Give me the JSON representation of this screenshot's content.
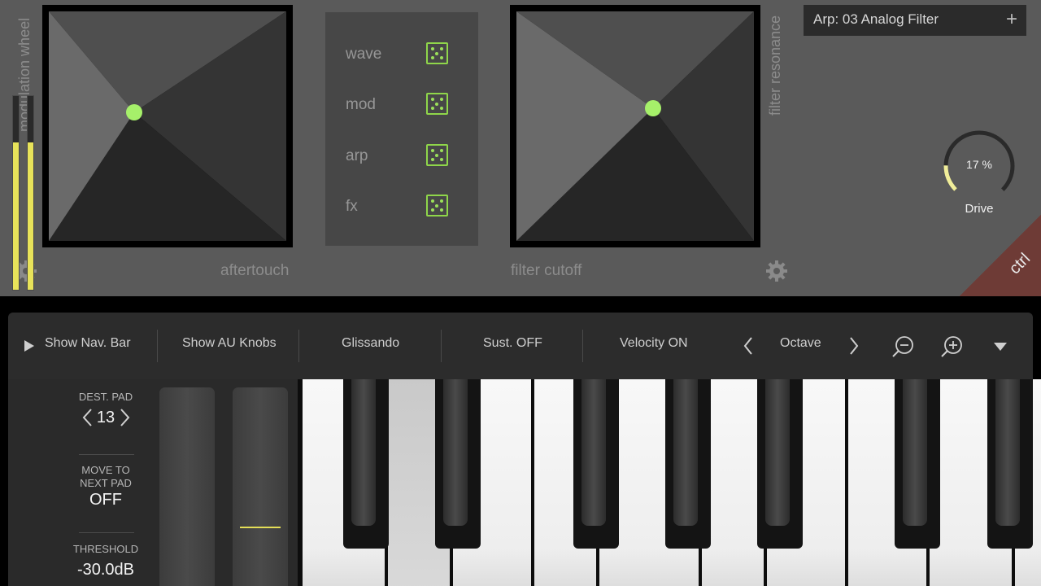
{
  "pads": {
    "left": {
      "x_label": "aftertouch",
      "y_label": "modulation wheel",
      "dot_color": "#a6f06a"
    },
    "right": {
      "x_label": "filter cutoff",
      "y_label": "filter resonance",
      "dot_color": "#a6f06a"
    }
  },
  "randomize": {
    "items": [
      {
        "label": "wave",
        "icon": "dice-icon"
      },
      {
        "label": "mod",
        "icon": "dice-icon"
      },
      {
        "label": "arp",
        "icon": "dice-icon"
      },
      {
        "label": "fx",
        "icon": "dice-icon"
      }
    ],
    "accent": "#8fd64a"
  },
  "preset": {
    "name": "Arp: 03 Analog Filter",
    "add_symbol": "+"
  },
  "drive_knob": {
    "value_text": "17 %",
    "label": "Drive",
    "value_fraction": 0.17,
    "arc_color": "#f1ee9a"
  },
  "ctrl": {
    "label": "ctrl",
    "color": "#6e3b36"
  },
  "navbar": {
    "show_nav_bar": "Show Nav. Bar",
    "show_au_knobs": "Show AU Knobs",
    "glissando": "Glissando",
    "sustain": "Sust. OFF",
    "velocity": "Velocity ON",
    "octave": "Octave"
  },
  "side_panel": {
    "dest_pad_label": "DEST. PAD",
    "dest_pad_value": "13",
    "move_label_1": "MOVE TO",
    "move_label_2": "NEXT PAD",
    "move_value": "OFF",
    "threshold_label": "THRESHOLD",
    "threshold_value": "-30.0dB"
  },
  "meters": {
    "left_level": 0.76,
    "right_level": 0.76,
    "color": "#e8e35a"
  },
  "sliders": {
    "second_level": 0.3,
    "line_color": "#e4de57"
  }
}
